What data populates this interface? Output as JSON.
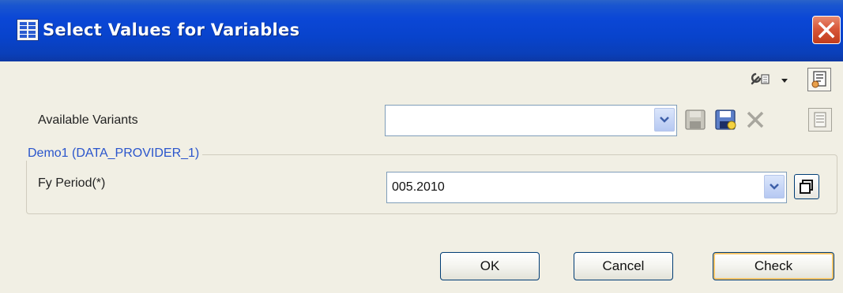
{
  "window": {
    "title": "Select Values for Variables",
    "title_icon": "grid-table-icon",
    "close_icon": "close-icon"
  },
  "toolbar": {
    "icons": [
      "wrench-settings-icon",
      "dropdown-arrow-icon",
      "personalize-dialog-icon"
    ]
  },
  "variants": {
    "label": "Available Variants",
    "value": "",
    "actions": [
      "save-variant-icon",
      "save-as-variant-icon",
      "delete-variant-icon",
      "variant-details-icon"
    ]
  },
  "group": {
    "title": "Demo1 (DATA_PROVIDER_1)",
    "fields": [
      {
        "label": "Fy Period(*)",
        "value": "005.2010"
      }
    ]
  },
  "buttons": {
    "ok": "OK",
    "cancel": "Cancel",
    "check": "Check"
  },
  "colors": {
    "titlebar": "#0843cc",
    "dialog_bg": "#f1efe4",
    "group_title": "#2a55cc",
    "close_button": "#d8573a"
  }
}
